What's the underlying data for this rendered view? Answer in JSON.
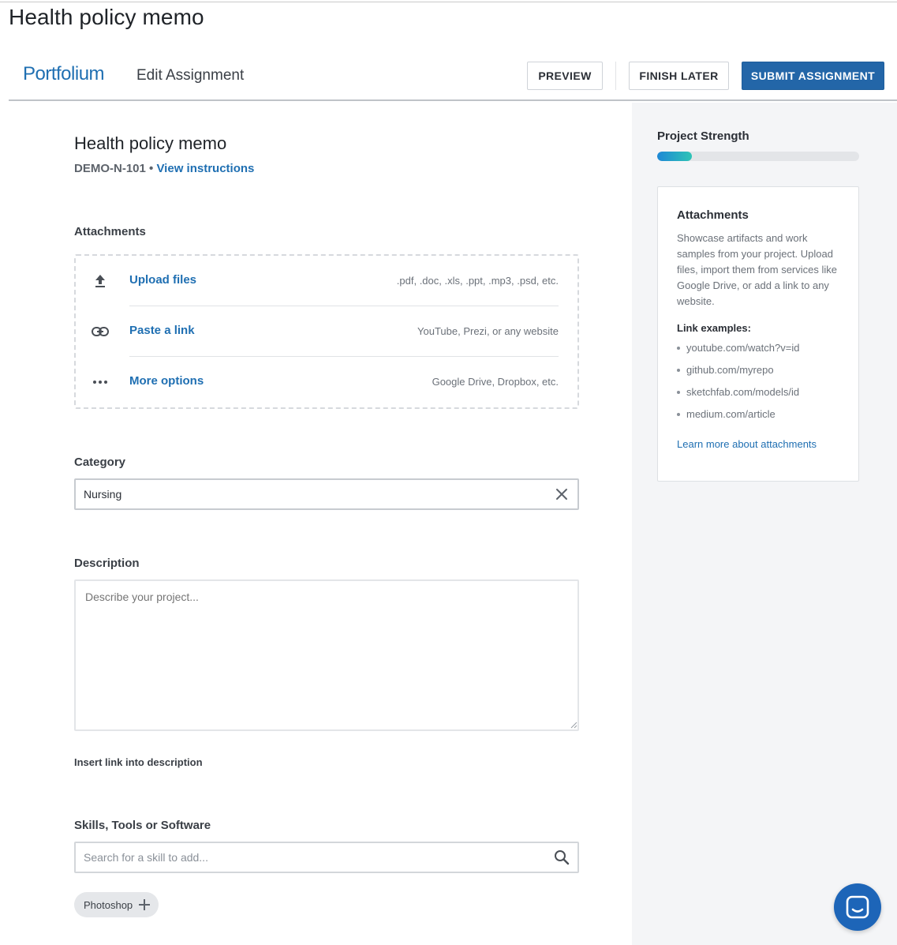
{
  "page": {
    "title": "Health policy memo"
  },
  "header": {
    "brand": "Portfolium",
    "title": "Edit Assignment",
    "preview_label": "PREVIEW",
    "finish_later_label": "FINISH LATER",
    "submit_label": "SUBMIT ASSIGNMENT",
    "accent_color": "#2366a8"
  },
  "assignment": {
    "title": "Health policy memo",
    "course_code": "DEMO-N-101",
    "separator": " • ",
    "instructions_link": "View instructions"
  },
  "attachments": {
    "label": "Attachments",
    "rows": [
      {
        "icon": "upload-icon",
        "label": "Upload files",
        "hint": ".pdf, .doc, .xls, .ppt, .mp3, .psd, etc."
      },
      {
        "icon": "link-icon",
        "label": "Paste a link",
        "hint": "YouTube, Prezi, or any website"
      },
      {
        "icon": "more-icon",
        "label": "More options",
        "hint": "Google Drive, Dropbox, etc."
      }
    ]
  },
  "category": {
    "label": "Category",
    "value": "Nursing"
  },
  "description": {
    "label": "Description",
    "placeholder": "Describe your project...",
    "insert_link": "Insert link into description"
  },
  "skills": {
    "label": "Skills, Tools or Software",
    "placeholder": "Search for a skill to add...",
    "suggestions": [
      "Photoshop"
    ]
  },
  "sidebar": {
    "strength_label": "Project Strength",
    "strength_fraction": 0.17,
    "tip": {
      "title": "Attachments",
      "body": "Showcase artifacts and work samples from your project. Upload files, import them from services like Google Drive, or add a link to any website.",
      "examples_label": "Link examples:",
      "examples": [
        "youtube.com/watch?v=id",
        "github.com/myrepo",
        "sketchfab.com/models/id",
        "medium.com/article"
      ],
      "learn_more": "Learn more about attachments"
    }
  }
}
